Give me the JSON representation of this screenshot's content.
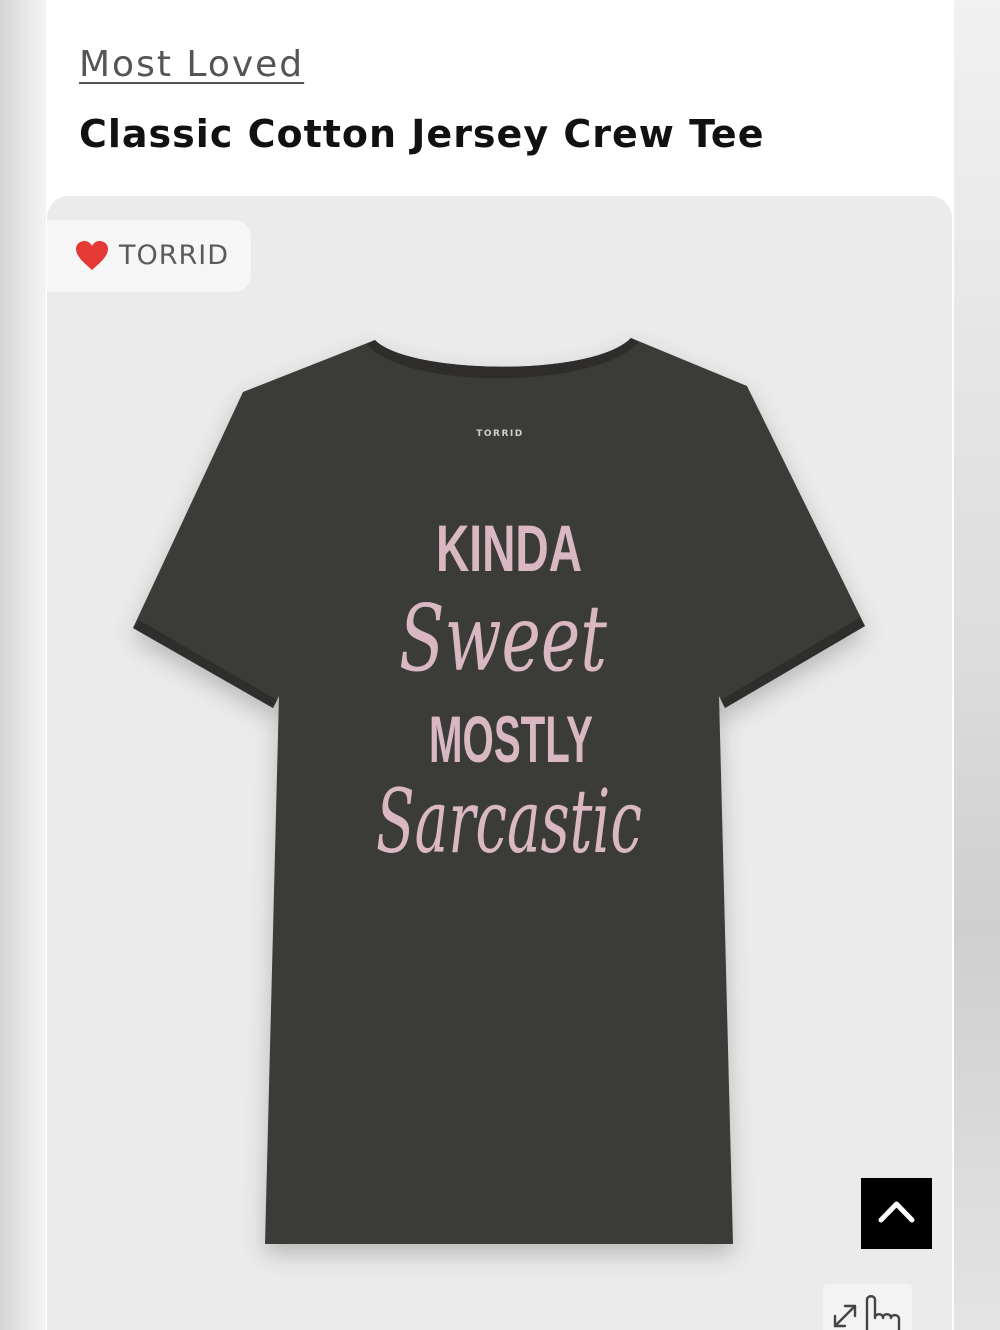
{
  "breadcrumb": {
    "label": "Most Loved"
  },
  "product": {
    "title": "Classic Cotton Jersey Crew Tee",
    "brand": "TORRID",
    "shirt_label": "TORRID",
    "print_lines": [
      "KINDA",
      "Sweet",
      "MOSTLY",
      "Sarcastic"
    ]
  },
  "icons": {
    "brand": "heart-icon",
    "back_to_top": "chevron-up-icon",
    "zoom": "expand-tap-icon"
  },
  "colors": {
    "heart": "#e53935",
    "tee": "#3b3a38",
    "print": "#d9b8c4",
    "button": "#000000"
  }
}
